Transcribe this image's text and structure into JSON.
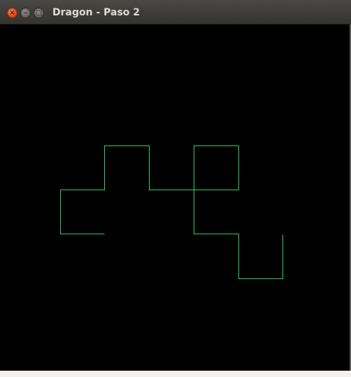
{
  "window": {
    "title": "Dragon - Paso 2",
    "controls": {
      "close_glyph": "×",
      "minimize_glyph": "–",
      "maximize_glyph": "□"
    }
  },
  "canvas": {
    "background": "#000000",
    "curve_color": "#33cc66",
    "curve": {
      "name": "dragon-curve",
      "points": [
        [
          149,
          334
        ],
        [
          86,
          334
        ],
        [
          86,
          271
        ],
        [
          149,
          271
        ],
        [
          149,
          208
        ],
        [
          213,
          208
        ],
        [
          213,
          271
        ],
        [
          277,
          271
        ],
        [
          341,
          271
        ],
        [
          341,
          208
        ],
        [
          277,
          208
        ],
        [
          277,
          271
        ],
        [
          277,
          334
        ],
        [
          341,
          334
        ],
        [
          341,
          398
        ],
        [
          404,
          398
        ],
        [
          404,
          335
        ]
      ]
    }
  }
}
